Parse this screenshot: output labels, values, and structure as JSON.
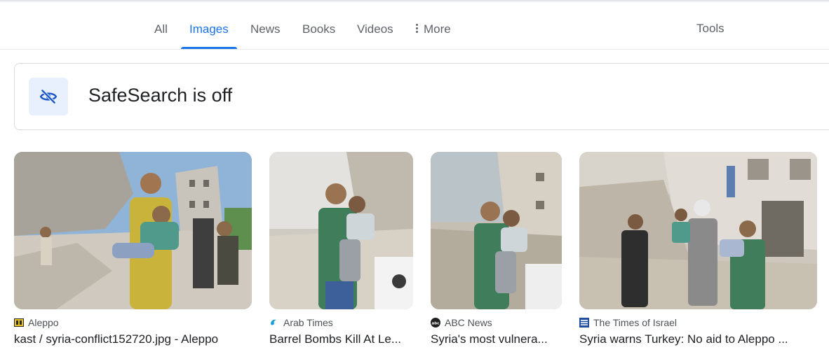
{
  "tabs": [
    {
      "label": "All",
      "active": false
    },
    {
      "label": "Images",
      "active": true
    },
    {
      "label": "News",
      "active": false
    },
    {
      "label": "Books",
      "active": false
    },
    {
      "label": "Videos",
      "active": false
    },
    {
      "label": "More",
      "active": false
    }
  ],
  "tools_label": "Tools",
  "safesearch": {
    "text": "SafeSearch is off",
    "icon": "eye-off-icon",
    "accent": "#1a73e8"
  },
  "results": [
    {
      "source": "Aleppo",
      "title": "kast / syria-conflict152720.jpg - Aleppo",
      "favicon": "aleppo-favicon"
    },
    {
      "source": "Arab Times",
      "title": "Barrel Bombs Kill At Le...",
      "favicon": "arab-times-favicon"
    },
    {
      "source": "ABC News",
      "title": "Syria's most vulnera...",
      "favicon": "abc-news-favicon"
    },
    {
      "source": "The Times of Israel",
      "title": "Syria warns Turkey: No aid to Aleppo ...",
      "favicon": "times-of-israel-favicon"
    }
  ]
}
